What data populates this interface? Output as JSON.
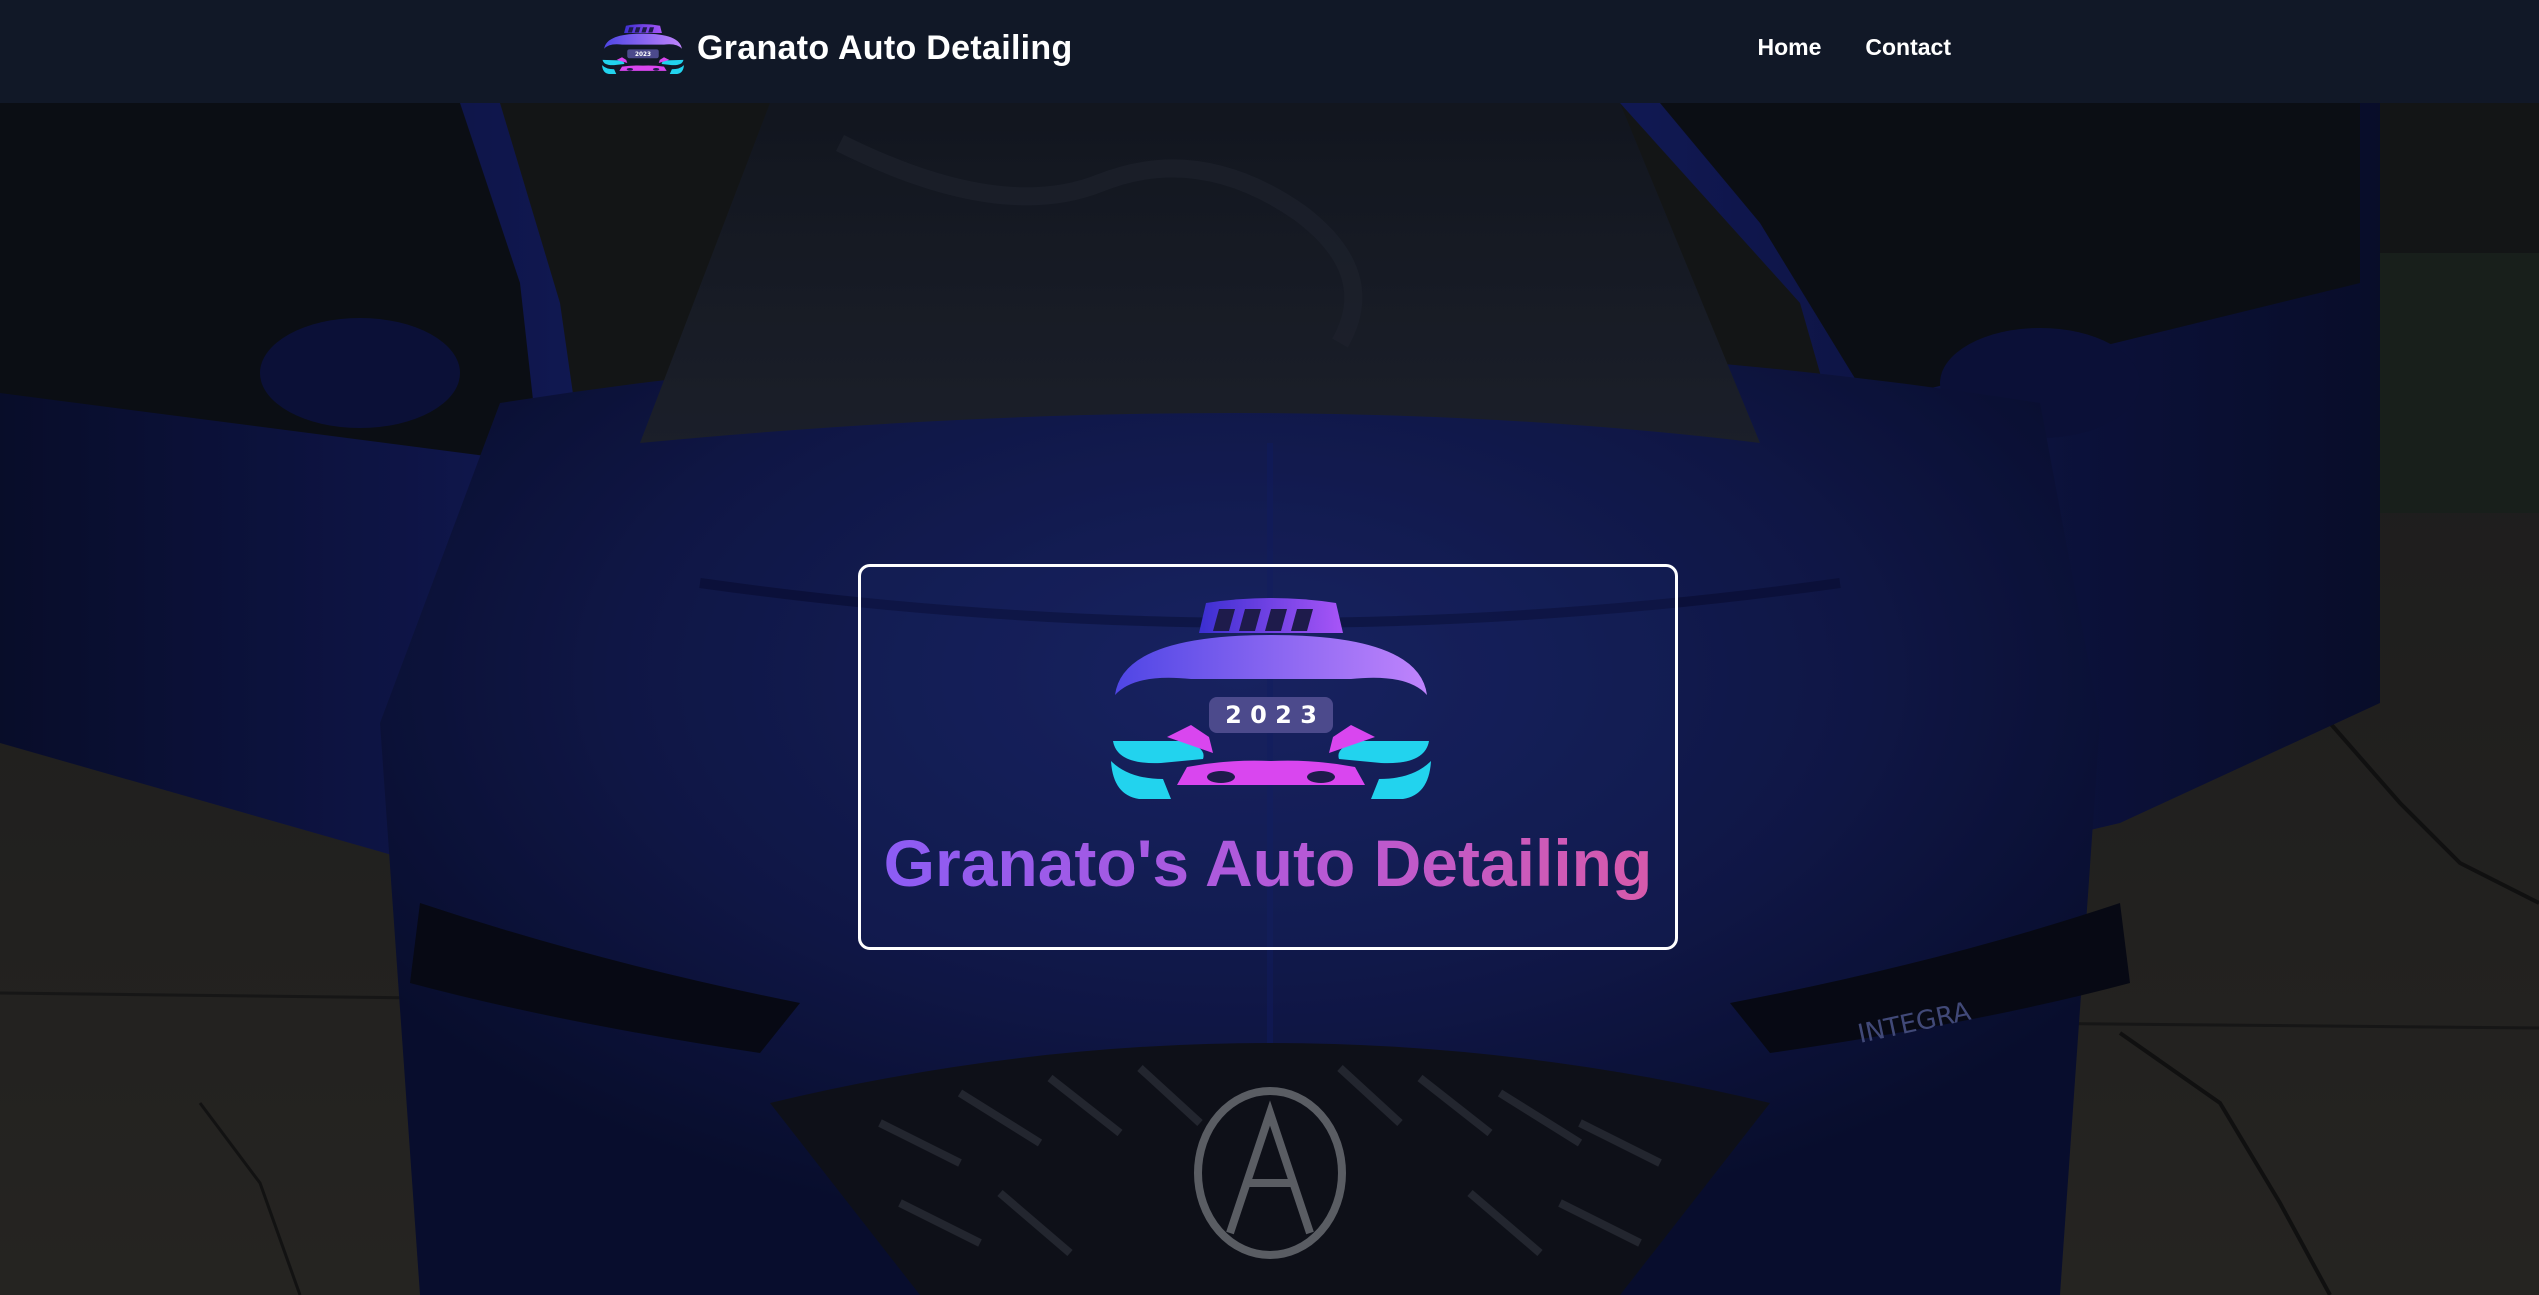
{
  "nav": {
    "brand_name": "Granato Auto Detailing",
    "logo_year": "2023",
    "links": [
      {
        "label": "Home"
      },
      {
        "label": "Contact"
      }
    ]
  },
  "hero": {
    "title": "Granato's Auto Detailing",
    "logo_year": "2 0 2 3",
    "car_badge": "INTEGRA",
    "background": "photo of a blue car with open doors in a driveway (darkened overlay)"
  },
  "colors": {
    "nav_bg": "#111827",
    "title_gradient_start": "#8a5cf6",
    "title_gradient_end": "#d95aa8",
    "logo_purple": "#7c3aed",
    "logo_cyan": "#22d3ee",
    "logo_pink": "#d946ef"
  }
}
